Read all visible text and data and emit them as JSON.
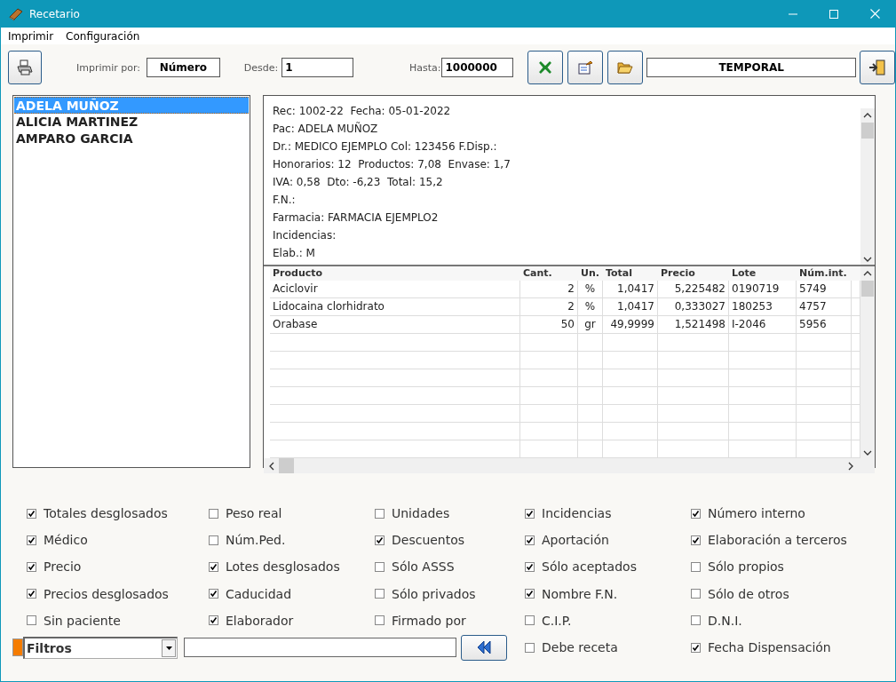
{
  "window": {
    "title": "Recetario"
  },
  "menu": [
    {
      "label": "Imprimir"
    },
    {
      "label": "Configuración"
    }
  ],
  "toolbar": {
    "print_by_label": "Imprimir por:",
    "print_by_value": "Número",
    "from_label": "Desde:",
    "from_value": "1",
    "to_label": "Hasta:",
    "to_value": "1000000",
    "folder_field": "TEMPORAL"
  },
  "patients": [
    {
      "name": "ADELA MUÑOZ",
      "selected": true
    },
    {
      "name": "ALICIA MARTINEZ",
      "selected": false
    },
    {
      "name": "AMPARO GARCIA",
      "selected": false
    }
  ],
  "detail_lines": [
    "Rec: 1002-22  Fecha: 05-01-2022",
    "Pac: ADELA MUÑOZ",
    "Dr.: MEDICO EJEMPLO Col: 123456 F.Disp.:",
    "Honorarios: 12  Productos: 7,08  Envase: 1,7",
    "IVA: 0,58  Dto: -6,23  Total: 15,2",
    "F.N.:",
    "Farmacia: FARMACIA EJEMPLO2",
    "Incidencias:",
    "Elab.: M"
  ],
  "table": {
    "columns": [
      "Producto",
      "Cant.",
      "Un.",
      "Total",
      "Precio",
      "Lote",
      "Núm.int."
    ],
    "rows": [
      {
        "cells": [
          "Aciclovir",
          "2",
          "%",
          "1,0417",
          "5,225482",
          "0190719",
          "5749"
        ]
      },
      {
        "cells": [
          "Lidocaina clorhidrato",
          "2",
          "%",
          "1,0417",
          "0,333027",
          "180253",
          "4757"
        ]
      },
      {
        "cells": [
          "Orabase",
          "50",
          "gr",
          "49,9999",
          "1,521498",
          "I-2046",
          "5956"
        ]
      }
    ]
  },
  "options": [
    {
      "items": [
        {
          "label": "Totales desglosados",
          "checked": true
        },
        {
          "label": "Médico",
          "checked": true
        },
        {
          "label": "Precio",
          "checked": true
        },
        {
          "label": "Precios desglosados",
          "checked": true
        },
        {
          "label": "Sin paciente",
          "checked": false
        }
      ]
    },
    {
      "items": [
        {
          "label": "Peso real",
          "checked": false
        },
        {
          "label": "Núm.Ped.",
          "checked": false
        },
        {
          "label": "Lotes desglosados",
          "checked": true
        },
        {
          "label": "Caducidad",
          "checked": true
        },
        {
          "label": "Elaborador",
          "checked": true
        }
      ]
    },
    {
      "items": [
        {
          "label": "Unidades",
          "checked": false
        },
        {
          "label": "Descuentos",
          "checked": true
        },
        {
          "label": "Sólo ASSS",
          "checked": false
        },
        {
          "label": "Sólo privados",
          "checked": false
        },
        {
          "label": "Firmado por",
          "checked": false
        }
      ]
    },
    {
      "items": [
        {
          "label": "Incidencias",
          "checked": true
        },
        {
          "label": "Aportación",
          "checked": true
        },
        {
          "label": "Sólo aceptados",
          "checked": true
        },
        {
          "label": "Nombre F.N.",
          "checked": true
        },
        {
          "label": "C.I.P.",
          "checked": false
        },
        {
          "label": "Debe receta",
          "checked": false
        }
      ]
    },
    {
      "items": [
        {
          "label": "Número interno",
          "checked": true
        },
        {
          "label": "Elaboración a terceros",
          "checked": true
        },
        {
          "label": "Sólo propios",
          "checked": false
        },
        {
          "label": "Sólo de otros",
          "checked": false
        },
        {
          "label": "D.N.I.",
          "checked": false
        },
        {
          "label": "Fecha Dispensación",
          "checked": true
        }
      ]
    }
  ],
  "filter": {
    "dropdown_value": "Filtros"
  }
}
